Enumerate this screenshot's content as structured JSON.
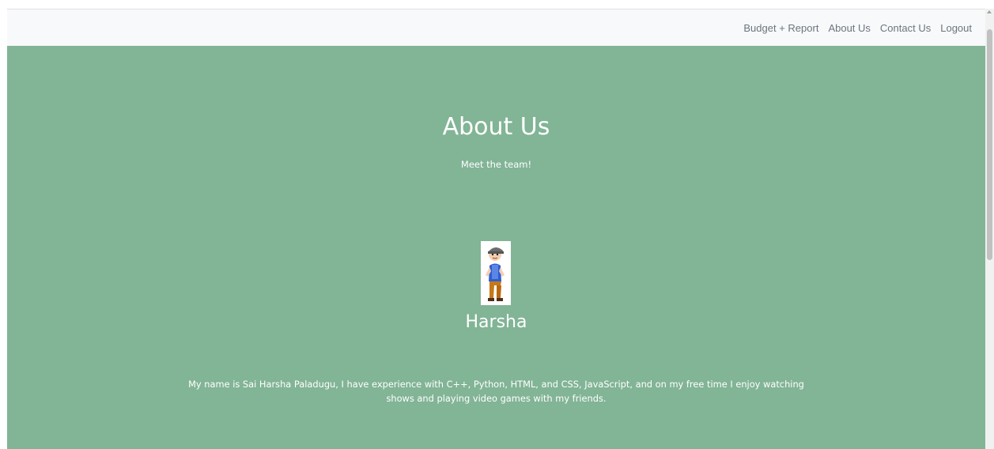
{
  "nav": {
    "links": [
      "Budget + Report",
      "About Us",
      "Contact Us",
      "Logout"
    ]
  },
  "hero": {
    "title": "About Us",
    "subtitle": "Meet the team!",
    "background_color": "#82b496"
  },
  "member": {
    "avatar_icon": "cartoon-boy-avatar-icon",
    "name": "Harsha",
    "bio": "My name is Sai Harsha Paladugu, I have experience with C++, Python, HTML, and CSS, JavaScript, and on my free time I enjoy watching shows and playing video games with my friends."
  }
}
